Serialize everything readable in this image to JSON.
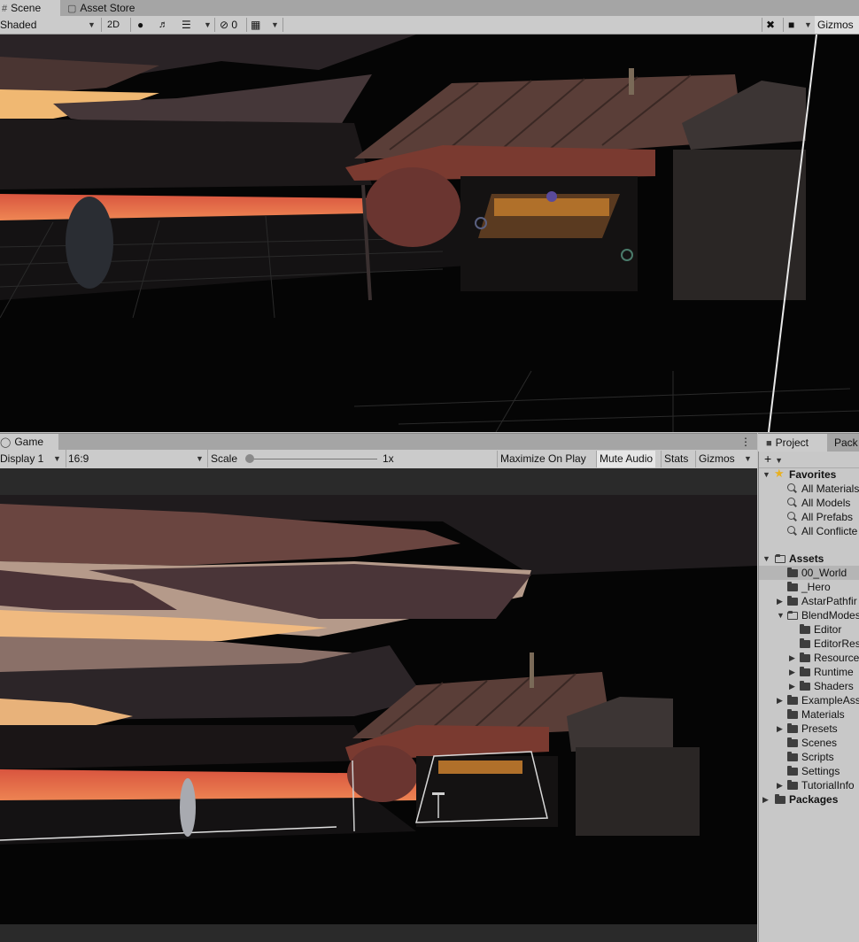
{
  "scene_tabs": [
    {
      "label": "Scene",
      "icon": "grid-icon"
    },
    {
      "label": "Asset Store",
      "icon": "shopping-bag-icon"
    }
  ],
  "scene_toolbar": {
    "draw_mode": "Shaded",
    "mode_2d": "2D",
    "hidden_count": "0",
    "gizmos": "Gizmos"
  },
  "game_tab": {
    "label": "Game",
    "icon": "gamepad-icon"
  },
  "game_toolbar": {
    "display": "Display 1",
    "aspect": "16:9",
    "scale_label": "Scale",
    "scale_value": "1x",
    "maximize": "Maximize On Play",
    "mute": "Mute Audio",
    "stats": "Stats",
    "gizmos": "Gizmos"
  },
  "project_tabs": [
    {
      "label": "Project",
      "icon": "folder-icon"
    },
    {
      "label": "Pack"
    }
  ],
  "project": {
    "add_label": "+",
    "favorites_label": "Favorites",
    "favorites": [
      "All Materials",
      "All Models",
      "All Prefabs",
      "All Conflicte"
    ],
    "assets_label": "Assets",
    "assets": [
      {
        "label": "00_World",
        "depth": 1,
        "arrow": "",
        "selected": true
      },
      {
        "label": "_Hero",
        "depth": 1,
        "arrow": ""
      },
      {
        "label": "AstarPathfir",
        "depth": 1,
        "arrow": "right"
      },
      {
        "label": "BlendModes",
        "depth": 1,
        "arrow": "down",
        "open": true
      },
      {
        "label": "Editor",
        "depth": 2,
        "arrow": ""
      },
      {
        "label": "EditorRes",
        "depth": 2,
        "arrow": ""
      },
      {
        "label": "Resource",
        "depth": 2,
        "arrow": "right"
      },
      {
        "label": "Runtime",
        "depth": 2,
        "arrow": "right"
      },
      {
        "label": "Shaders",
        "depth": 2,
        "arrow": "right"
      },
      {
        "label": "ExampleAss",
        "depth": 1,
        "arrow": "right"
      },
      {
        "label": "Materials",
        "depth": 1,
        "arrow": ""
      },
      {
        "label": "Presets",
        "depth": 1,
        "arrow": "right"
      },
      {
        "label": "Scenes",
        "depth": 1,
        "arrow": ""
      },
      {
        "label": "Scripts",
        "depth": 1,
        "arrow": ""
      },
      {
        "label": "Settings",
        "depth": 1,
        "arrow": ""
      },
      {
        "label": "TutorialInfo",
        "depth": 1,
        "arrow": "right"
      }
    ],
    "packages_label": "Packages"
  },
  "colors": {
    "accent_star": "#e8b020",
    "sunset": "#e8654a",
    "sky_gold": "#f0b070"
  }
}
